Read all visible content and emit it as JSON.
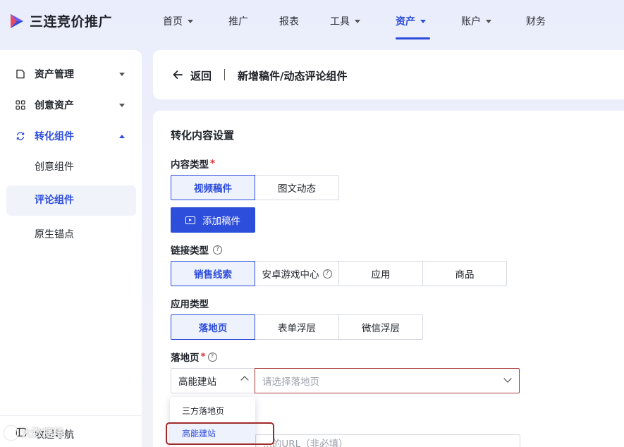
{
  "brand": {
    "name": "三连竞价推广"
  },
  "topnav": {
    "items": [
      {
        "label": "首页",
        "has_caret": true
      },
      {
        "label": "推广",
        "has_caret": false
      },
      {
        "label": "报表",
        "has_caret": false
      },
      {
        "label": "工具",
        "has_caret": true
      },
      {
        "label": "资产",
        "has_caret": true,
        "active": true
      },
      {
        "label": "账户",
        "has_caret": true
      },
      {
        "label": "财务",
        "has_caret": false
      }
    ]
  },
  "sidebar": {
    "groups": [
      {
        "label": "资产管理",
        "icon": "document-icon"
      },
      {
        "label": "创意资产",
        "icon": "grid-icon"
      },
      {
        "label": "转化组件",
        "icon": "refresh-icon",
        "open": true
      }
    ],
    "subitems": [
      {
        "label": "创意组件"
      },
      {
        "label": "评论组件",
        "active": true
      },
      {
        "label": "原生锚点"
      }
    ],
    "collapse_label": "收起导航"
  },
  "header": {
    "back_label": "返回",
    "title": "新增稿件/动态评论组件"
  },
  "form": {
    "section_title": "转化内容设置",
    "content_type": {
      "label": "内容类型",
      "options": [
        "视频稿件",
        "图文动态"
      ],
      "selected": "视频稿件"
    },
    "add_button_label": "添加稿件",
    "link_type": {
      "label": "链接类型",
      "options": [
        "销售线索",
        "安卓游戏中心",
        "应用",
        "商品"
      ],
      "selected": "销售线索"
    },
    "app_type": {
      "label": "应用类型",
      "options": [
        "落地页",
        "表单浮层",
        "微信浮层"
      ],
      "selected": "落地页"
    },
    "landing_page": {
      "label": "落地页",
      "source_value": "高能建站",
      "placeholder": "请选择落地页",
      "dropdown_options": [
        "三方落地页",
        "高能建站"
      ],
      "dropdown_selected": "高能建站"
    },
    "url_placeholder": "...的URL（非必填）"
  },
  "watermark": {
    "text": "大数据精"
  },
  "colors": {
    "accent": "#2d4ddb",
    "error": "#e0343a",
    "highlight": "#a02a2a"
  }
}
